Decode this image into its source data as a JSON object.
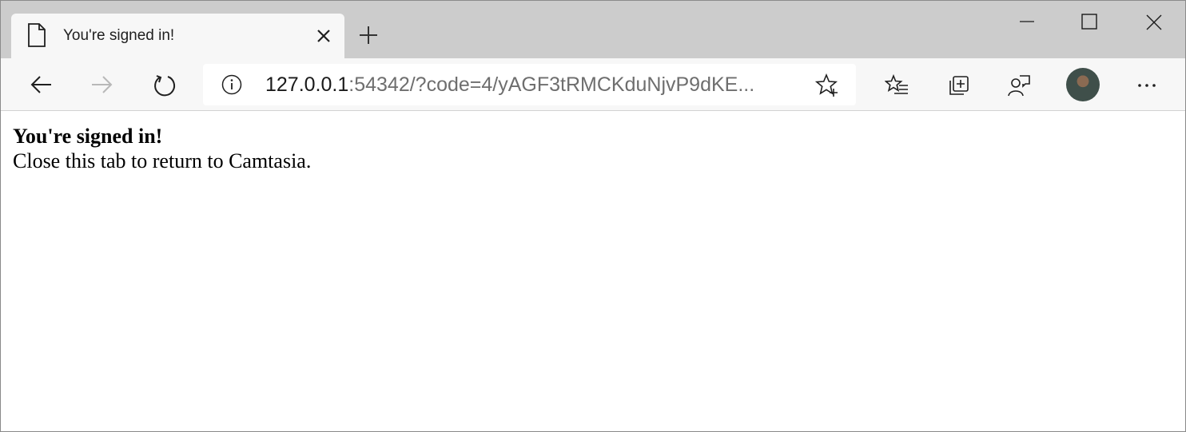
{
  "tab": {
    "title": "You're signed in!"
  },
  "address_bar": {
    "url_host": "127.0.0.1",
    "url_rest": ":54342/?code=4/yAGF3tRMCKduNjvP9dKE..."
  },
  "page": {
    "heading": "You're signed in!",
    "message": "Close this tab to return to Camtasia."
  },
  "icons": {
    "tab": "page-icon",
    "tab_close": "close-icon",
    "new_tab": "plus-icon",
    "minimize": "minimize-icon",
    "maximize": "maximize-icon",
    "close": "close-icon",
    "back": "arrow-left-icon",
    "forward": "arrow-right-icon",
    "refresh": "refresh-icon",
    "site_info": "info-icon",
    "add_favorite": "star-plus-icon",
    "favorites": "favorites-list-icon",
    "collections": "collections-icon",
    "feedback": "feedback-icon",
    "profile": "avatar",
    "more": "ellipsis-icon"
  },
  "colors": {
    "tabstrip": "#cccccc",
    "toolbar": "#f7f7f7",
    "url_host": "#1a1a1a",
    "url_rest": "#6e6e6e",
    "forward_disabled": "#b8b8b8"
  }
}
